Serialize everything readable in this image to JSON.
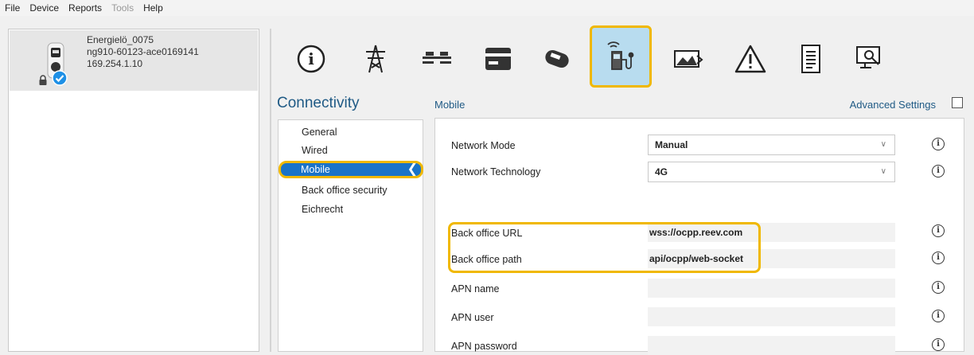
{
  "menu": [
    "File",
    "Device",
    "Reports",
    "Tools",
    "Help"
  ],
  "menu_disabled": "Tools",
  "device": {
    "name": "Energielö_0075",
    "serial": "ng910-60123-ace0169141",
    "ip": "169.254.1.10"
  },
  "toolbar": {
    "icons": [
      "info-icon",
      "power-tower-icon",
      "balance-icon",
      "payment-card-icon",
      "card-reader-icon",
      "charging-station-signal-icon",
      "image-icon",
      "warning-icon",
      "document-icon",
      "monitor-search-icon"
    ],
    "selected": "charging-station-signal-icon"
  },
  "section": {
    "title": "Connectivity",
    "nav": [
      "General",
      "Wired",
      "Mobile",
      "Back office security",
      "Eichrecht"
    ],
    "active": "Mobile"
  },
  "panel": {
    "title": "Mobile",
    "advanced_label": "Advanced Settings",
    "network_mode_label": "Network Mode",
    "network_mode_value": "Manual",
    "network_tech_label": "Network Technology",
    "network_tech_value": "4G",
    "back_office_url_label": "Back office URL",
    "back_office_url_value": "wss://ocpp.reev.com",
    "back_office_path_label": "Back office path",
    "back_office_path_value": "api/ocpp/web-socket",
    "apn_name_label": "APN name",
    "apn_name_value": "",
    "apn_user_label": "APN user",
    "apn_user_value": "",
    "apn_password_label": "APN password",
    "apn_password_value": ""
  },
  "colors": {
    "accent_blue": "#1a73c8",
    "highlight": "#f0b800",
    "title_blue": "#1f5a85"
  }
}
